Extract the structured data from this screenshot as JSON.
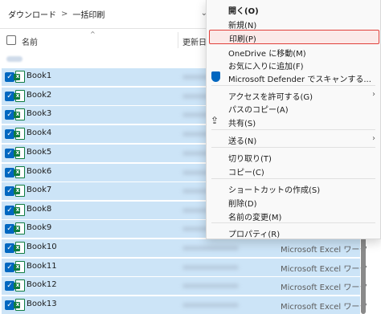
{
  "address_bar": {
    "crumbs": [
      "ダウンロード",
      "一括印刷"
    ],
    "separator": ">"
  },
  "columns": {
    "name": "名前",
    "date": "更新日"
  },
  "files": [
    {
      "name": "Book1",
      "type": ""
    },
    {
      "name": "Book2",
      "type": ""
    },
    {
      "name": "Book3",
      "type": ""
    },
    {
      "name": "Book4",
      "type": ""
    },
    {
      "name": "Book5",
      "type": ""
    },
    {
      "name": "Book6",
      "type": ""
    },
    {
      "name": "Book7",
      "type": ""
    },
    {
      "name": "Book8",
      "type": ""
    },
    {
      "name": "Book9",
      "type": ""
    },
    {
      "name": "Book10",
      "type": "Microsoft Excel ワーク"
    },
    {
      "name": "Book11",
      "type": "Microsoft Excel ワーク"
    },
    {
      "name": "Book12",
      "type": "Microsoft Excel ワーク"
    },
    {
      "name": "Book13",
      "type": "Microsoft Excel ワーク"
    }
  ],
  "context_menu": {
    "open": "開く(O)",
    "new": "新規(N)",
    "print": "印刷(P)",
    "onedrive": "OneDrive に移動(M)",
    "favorites": "お気に入りに追加(F)",
    "defender": "Microsoft Defender でスキャンする...",
    "access": "アクセスを許可する(G)",
    "copy_path": "パスのコピー(A)",
    "share": "共有(S)",
    "send_to": "送る(N)",
    "cut": "切り取り(T)",
    "copy": "コピー(C)",
    "shortcut": "ショートカットの作成(S)",
    "delete": "削除(D)",
    "rename": "名前の変更(M)",
    "properties": "プロパティ(R)"
  },
  "icons": {
    "checkbox": "check-icon",
    "file": "excel-file-icon",
    "defender": "shield-icon",
    "share": "share-icon",
    "submenu": "chevron-right-icon"
  },
  "colors": {
    "selection": "#cce4f7",
    "highlight_border": "#e0403b",
    "checkbox": "#0067c0",
    "excel": "#107c41"
  }
}
